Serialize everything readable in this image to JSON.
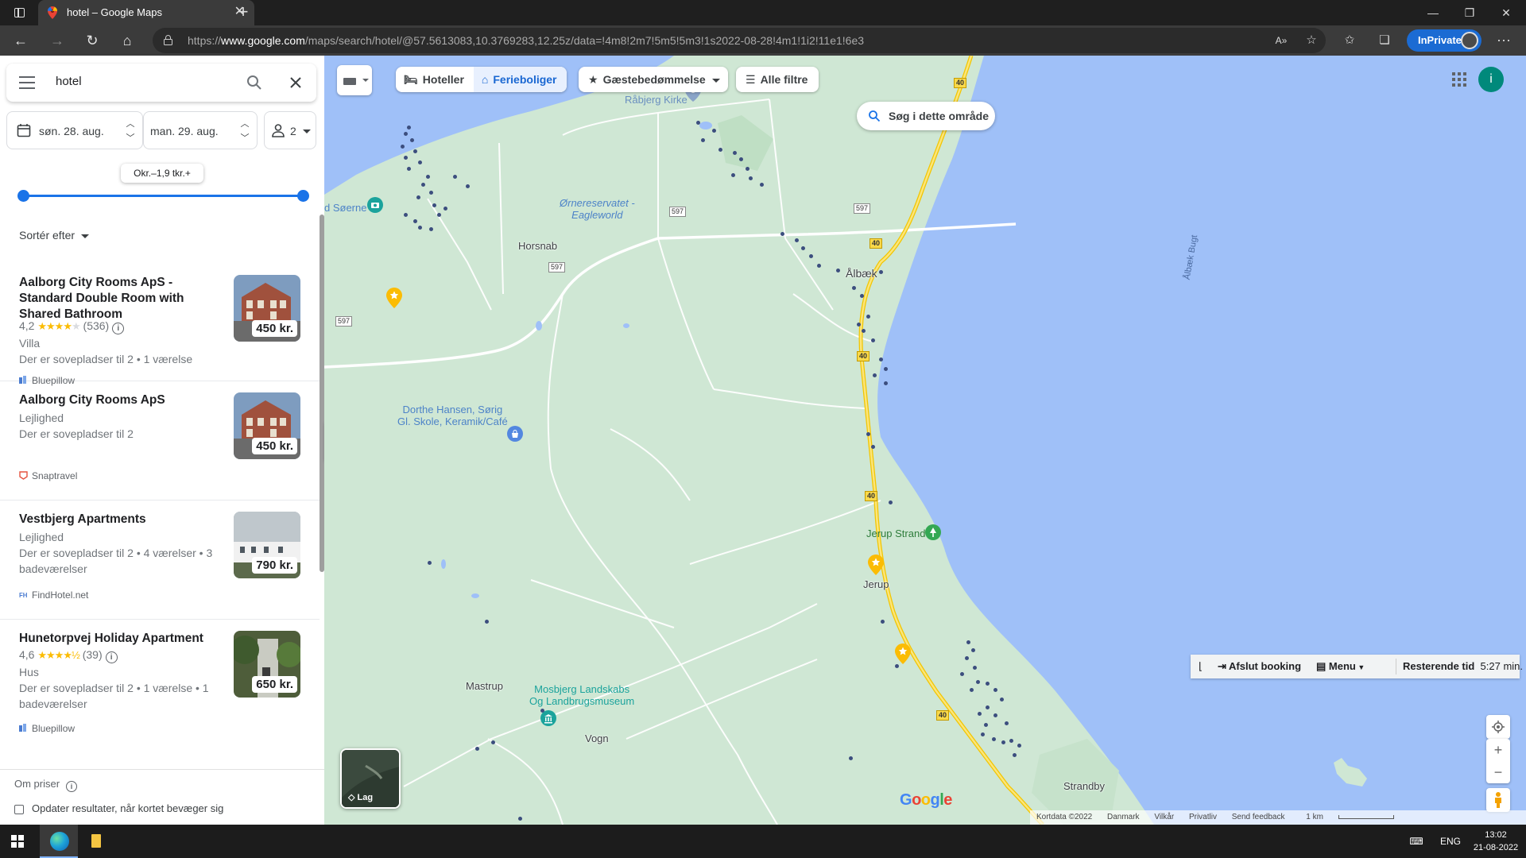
{
  "browser": {
    "tab_title": "hotel – Google Maps",
    "url_prefix": "https://",
    "url_domain": "www.google.com",
    "url_rest": "/maps/search/hotel/@57.5613083,10.3769283,12.25z/data=!4m8!2m7!5m5!5m3!1s2022-08-28!4m1!1i2!11e1!6e3",
    "inprivate_label": "InPrivate"
  },
  "search": {
    "query": "hotel"
  },
  "dates": {
    "checkin": "søn. 28. aug.",
    "checkout": "man. 29. aug.",
    "guests": "2"
  },
  "price_filter": {
    "tooltip": "Okr.–1,9 tkr.+"
  },
  "sort_label": "Sortér efter",
  "results": [
    {
      "title": "Aalborg City Rooms ApS - Standard Double Room with Shared Bathroom",
      "rating": "4,2",
      "stars": 4,
      "reviews": "(536)",
      "type": "Villa",
      "details": "Der er sovepladser til 2 • 1 værelse",
      "source": "Bluepillow",
      "price": "450 kr."
    },
    {
      "title": "Aalborg City Rooms ApS",
      "type": "Lejlighed",
      "details": "Der er sovepladser til 2",
      "source": "Snaptravel",
      "price": "450 kr."
    },
    {
      "title": "Vestbjerg Apartments",
      "type": "Lejlighed",
      "details": "Der er sovepladser til 2 • 4 værelser • 3 badeværelser",
      "source": "FindHotel.net",
      "price": "790 kr."
    },
    {
      "title": "Hunetorpvej Holiday Apartment",
      "rating": "4,6",
      "stars": 4.5,
      "reviews": "(39)",
      "type": "Hus",
      "details": "Der er sovepladser til 2 • 1 værelse • 1 badeværelser",
      "source": "Bluepillow",
      "price": "650 kr."
    }
  ],
  "footer": {
    "about_prices": "Om priser",
    "update_results": "Opdater resultater, når kortet bevæger sig"
  },
  "map": {
    "chips": {
      "hotels": "Hoteller",
      "vacation": "Ferieboliger",
      "rating": "Gæstebedømmelse",
      "all_filters": "Alle filtre"
    },
    "search_area": "Søg i dette område",
    "account_initial": "i",
    "layers": "Lag",
    "places": {
      "rabjerg": "Råbjerg Kirke",
      "ornereservat": "Ørnereservatet -",
      "eagleworld": "Eagleworld",
      "horsnab": "Horsnab",
      "albaek": "Ålbæk",
      "albaek_bugt": "Ålbæk Bugt",
      "soerne": "d Søerne",
      "dorthe1": "Dorthe Hansen, Sørig",
      "dorthe2": "Gl. Skole, Keramik/Café",
      "jerup_strand": "Jerup Strand",
      "jerup": "Jerup",
      "mastrup": "Mastrup",
      "mosbjerg1": "Mosbjerg Landskabs",
      "mosbjerg2": "Og Landbrugsmuseum",
      "vogn": "Vogn",
      "strandby": "Strandby"
    },
    "road_40": "40",
    "road_597": "597",
    "booking_bar": {
      "finish": "Afslut booking",
      "menu": "Menu",
      "remaining_label": "Resterende tid",
      "remaining_value": "5:27 min."
    },
    "attribution": {
      "data": "Kortdata ©2022",
      "country": "Danmark",
      "terms": "Vilkår",
      "privacy": "Privatliv",
      "feedback": "Send feedback",
      "scale": "1 km"
    },
    "google_logo": "Google"
  },
  "taskbar": {
    "lang": "ENG",
    "time": "13:02",
    "date": "21-08-2022"
  },
  "colors": {
    "map_land": "#cfe7d4",
    "map_water": "#9fc0f8",
    "accent": "#1a73e8",
    "road_yellow": "#f9d94a"
  }
}
